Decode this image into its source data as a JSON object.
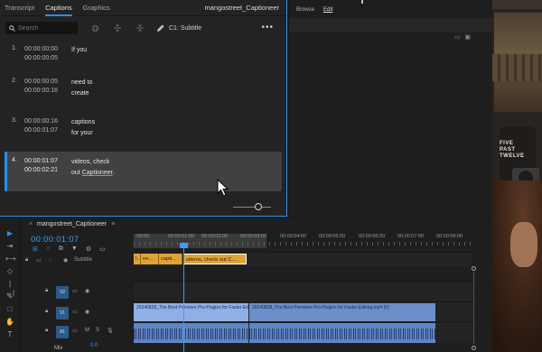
{
  "captions_panel": {
    "tabs": [
      "Transcript",
      "Captions",
      "Graphics"
    ],
    "active_tab": "Captions",
    "sequence_title": "mangostreet_Captioneer",
    "search_placeholder": "Search",
    "track_label": "C1: Subtitle",
    "more_label": "•••",
    "rows": [
      {
        "num": "1.",
        "in": "00:00:00:00",
        "out": "00:00:00:05",
        "line1": "If you",
        "line2": ""
      },
      {
        "num": "2.",
        "in": "00:00:00:05",
        "out": "00:00:00:16",
        "line1": "need to",
        "line2": "create"
      },
      {
        "num": "3.",
        "in": "00:00:00:16",
        "out": "00:00:01:07",
        "line1": "captions",
        "line2": "for your"
      },
      {
        "num": "4.",
        "in": "00:00:01:07",
        "out": "00:00:02:21",
        "line1": "videos, check",
        "line2_pre": "out ",
        "line2_link": "Captioneer",
        "line2_post": "."
      }
    ],
    "selected_row": 4
  },
  "browse_panel": {
    "tabs": [
      "Browse",
      "Edit"
    ],
    "active_tab": "Edit"
  },
  "preview": {
    "sign_lines": [
      "FIVE",
      "PAST",
      "TWELVE"
    ]
  },
  "timeline": {
    "sequence_tab": "mangostreet_Captioneer",
    "close_glyph": "≡",
    "timecode": "00:00:01:07",
    "ruler_labels": [
      ":00:00",
      "00:00:01:00",
      "00:00:02:00",
      "00:00:03:00",
      "00:00:04:00",
      "00:00:05:00",
      "00:00:06:00",
      "00:00:07:00",
      "00:00:08:00"
    ],
    "subtitle_track_name": "Subtitle",
    "caption_clips": [
      "I...",
      "ne...",
      "capti...",
      "videos, check out C..."
    ],
    "tracks": {
      "v2": "V2",
      "v1": "V1",
      "a1": "A1"
    },
    "video_clips": [
      "20240828_The Best Premiere Pro Plugins for Faster Edit",
      "20240828_The Best Premiere Pro Plugins for Faster Editing.mp4 [V]"
    ],
    "audio_track_letters": [
      "M",
      "S"
    ],
    "mix_label": "Mix",
    "mix_value": "0.0"
  },
  "colors": {
    "accent": "#2d8ceb",
    "caption_clip": "#e0a338",
    "video_clip": "#8fb0e6",
    "audio_clip": "#5f86c4"
  }
}
